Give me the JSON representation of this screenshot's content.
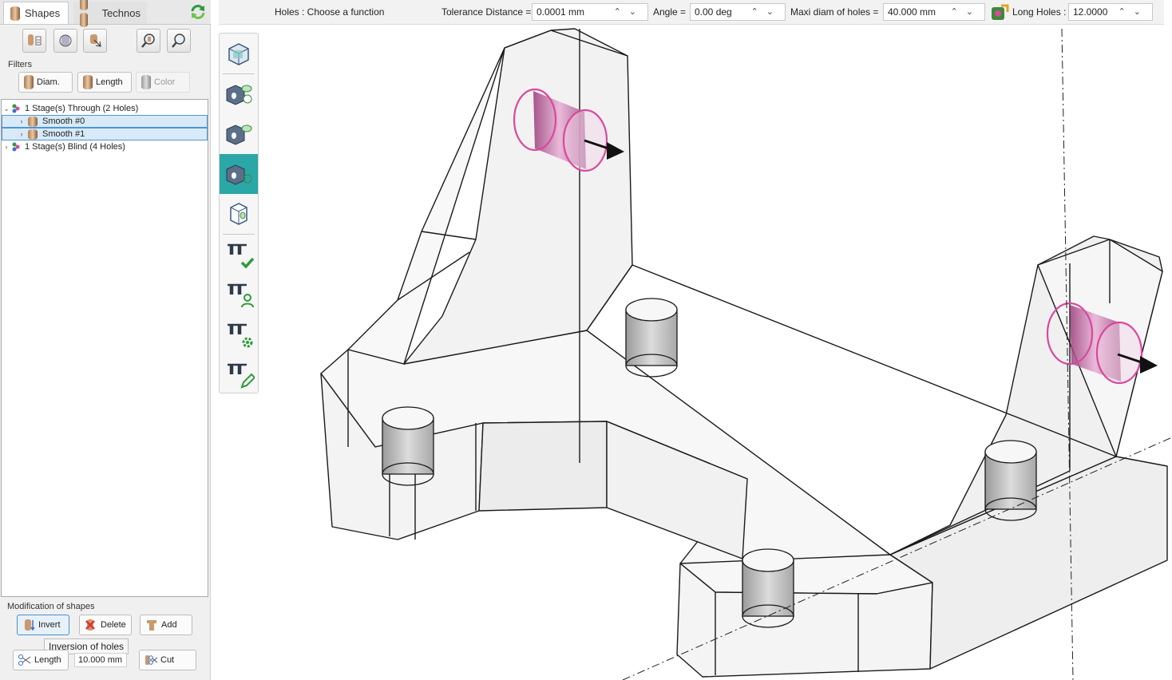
{
  "tabs": [
    {
      "label": "Shapes"
    },
    {
      "label": "Technos"
    }
  ],
  "filters": {
    "title": "Filters",
    "buttons": [
      {
        "label": "Diam."
      },
      {
        "label": "Length"
      },
      {
        "label": "Color",
        "enabled": false
      }
    ]
  },
  "tree": [
    {
      "label": "1 Stage(s) Through (2 Holes)",
      "expanded": true
    },
    {
      "label": "Smooth #0",
      "selected": true
    },
    {
      "label": "Smooth #1",
      "selected": true
    },
    {
      "label": "1 Stage(s) Blind (4 Holes)",
      "expanded": false
    }
  ],
  "modification": {
    "title": "Modification of shapes",
    "invert_label": "Invert",
    "delete_label": "Delete",
    "add_label": "Add",
    "tooltip": "Inversion of holes",
    "length_label": "Length",
    "length_value": "10.000 mm",
    "cut_label": "Cut"
  },
  "toolbar": {
    "status": "Holes : Choose a function",
    "tolerance_label": "Tolerance Distance =",
    "tolerance_value": "0.0001 mm",
    "angle_label": "Angle =",
    "angle_value": "0.00 deg",
    "maxi_label": "Maxi diam of holes =",
    "maxi_value": "40.000 mm",
    "long_label": "Long Holes :",
    "long_value": "12.0000"
  },
  "colors": {
    "accent": "#2aa7a7",
    "selection": "#4f95d6",
    "hole_highlight": "#d9489c"
  }
}
